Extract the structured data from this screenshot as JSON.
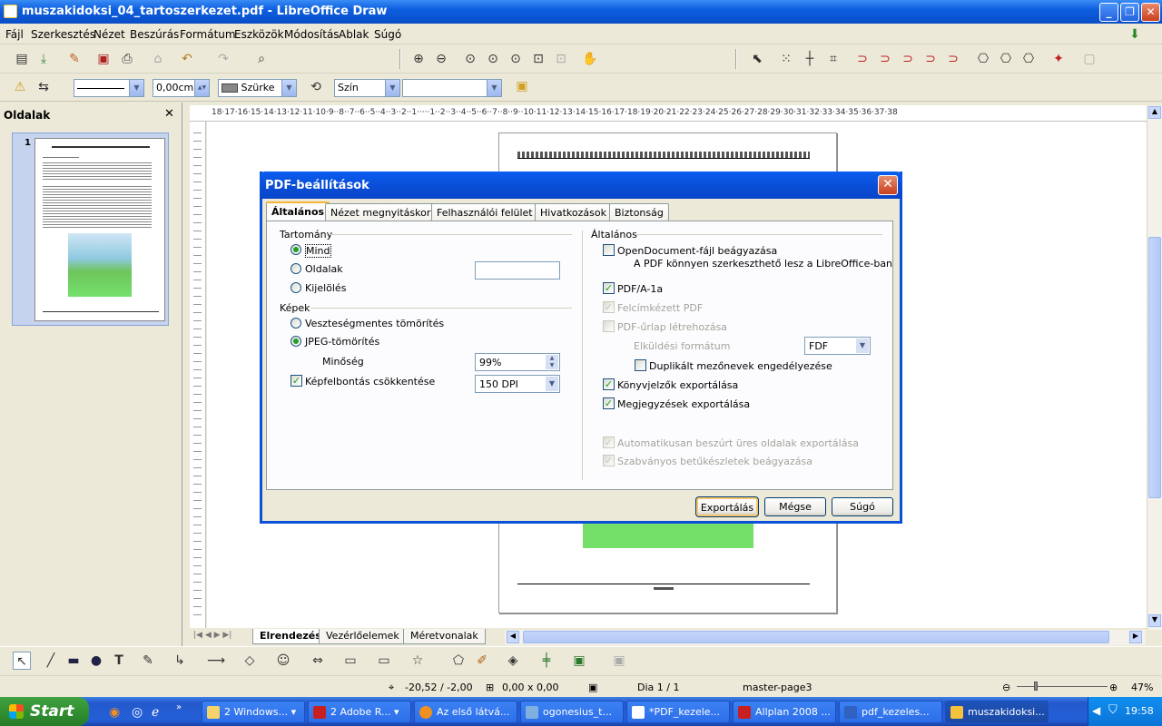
{
  "window": {
    "title": "muszakidoksi_04_tartoszerkezet.pdf - LibreOffice Draw"
  },
  "menu": [
    "Fájl",
    "Szerkesztés",
    "Nézet",
    "Beszúrás",
    "Formátum",
    "Eszközök",
    "Módosítás",
    "Ablak",
    "Súgó"
  ],
  "toolbar2": {
    "line_width": "0,00cm",
    "fill_color": "Szürke",
    "color_mode": "Szín",
    "fill_value": ""
  },
  "sidepanel": {
    "title": "Oldalak",
    "page_number": "1"
  },
  "ruler": {
    "h_ticks": "18·17·16·15·14·13·12·11·10·9··8··7··6··5··4··3··2··1·····1··2··3··4··5··6··7··8··9··10·11·12·13·14·15·16·17·18·19·20·21·22·23·24·25·26·27·28·29·30·31·32·33·34·35·36·37·38"
  },
  "layout_tabs": [
    "Elrendezés",
    "Vezérlőelemek",
    "Méretvonalak"
  ],
  "statusbar": {
    "position": "-20,52 / -2,00",
    "size": "0,00 x 0,00",
    "page": "Dia 1 / 1",
    "master": "master-page3",
    "zoom": "47%"
  },
  "dialog": {
    "title": "PDF-beállítások",
    "tabs": [
      "Általános",
      "Nézet megnyitáskor",
      "Felhasználói felület",
      "Hivatkozások",
      "Biztonság"
    ],
    "range": {
      "heading": "Tartomány",
      "options": [
        "Mind",
        "Oldalak",
        "Kijelölés"
      ],
      "selected": "Mind",
      "pages_value": ""
    },
    "images": {
      "heading": "Képek",
      "options": [
        "Veszteségmentes tömörítés",
        "JPEG-tömörítés"
      ],
      "selected": "JPEG-tömörítés",
      "quality_label": "Minőség",
      "quality_value": "99%",
      "reduce_label": "Képfelbontás csökkentése",
      "reduce_checked": true,
      "dpi_value": "150 DPI"
    },
    "general": {
      "heading": "Általános",
      "embed_label": "OpenDocument-fájl beágyazása",
      "embed_note": "A PDF könnyen szerkeszthető lesz a LibreOffice-ban",
      "pdfa_label": "PDF/A-1a",
      "tagged_label": "Felcímkézett PDF",
      "form_label": "PDF-űrlap létrehozása",
      "submit_label": "Elküldési formátum",
      "submit_value": "FDF",
      "dup_label": "Duplikált mezőnevek engedélyezése",
      "bookmarks_label": "Könyvjelzők exportálása",
      "comments_label": "Megjegyzések exportálása",
      "empty_pages_label": "Automatikusan beszúrt üres oldalak exportálása",
      "std_fonts_label": "Szabványos betűkészletek beágyazása"
    },
    "buttons": {
      "export": "Exportálás",
      "cancel": "Mégse",
      "help": "Súgó"
    }
  },
  "taskbar": {
    "start": "Start",
    "items": [
      "2 Windows...",
      "2 Adobe R...",
      "Az első látvá...",
      "ogonesius_t...",
      "*PDF_kezele...",
      "Allplan 2008 ...",
      "pdf_kezeles...",
      "muszakidoksi..."
    ],
    "time": "19:58"
  },
  "colors": {
    "accent": "#0a53d0",
    "checkmark": "#21a121",
    "page_image": "#74e06a"
  }
}
